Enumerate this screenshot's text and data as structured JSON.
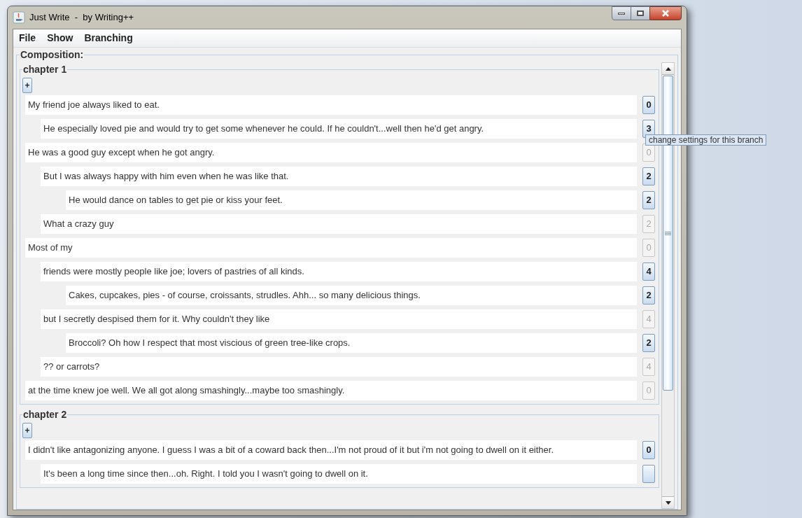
{
  "window": {
    "title": "Just Write  -  by Writing++"
  },
  "menu": [
    "File",
    "Show",
    "Branching"
  ],
  "composition": {
    "label": "Composition:",
    "chapters": [
      {
        "title": "chapter 1",
        "add_button": "+",
        "branches": [
          {
            "text": "My friend joe always liked to eat.",
            "count": "0",
            "enabled": true,
            "children": [
              {
                "text": "He especially loved pie and would try to get some whenever he could. If he couldn't...well then he'd get angry.",
                "count": "3",
                "enabled": true,
                "tooltip": "change settings for this branch"
              }
            ]
          },
          {
            "text": "He was a good guy except when he got angry.",
            "count": "0",
            "enabled": false,
            "children": [
              {
                "text": "But I was always happy with him even when he was like that.",
                "count": "2",
                "enabled": true,
                "children": [
                  {
                    "text": "He would dance on tables to get pie or kiss your feet.",
                    "count": "2",
                    "enabled": true
                  }
                ]
              },
              {
                "text": "What a crazy guy",
                "count": "2",
                "enabled": false
              }
            ]
          },
          {
            "text": "Most of my",
            "count": "0",
            "enabled": false,
            "children": [
              {
                "text": "friends were mostly people like joe; lovers of pastries of all kinds.",
                "count": "4",
                "enabled": true,
                "children": [
                  {
                    "text": "Cakes, cupcakes, pies - of course, croissants, strudles. Ahh... so many delicious things.",
                    "count": "2",
                    "enabled": true
                  }
                ]
              },
              {
                "text": "but I secretly despised them for it. Why couldn't they like",
                "count": "4",
                "enabled": false,
                "children": [
                  {
                    "text": "Broccoli? Oh how I respect that most viscious of green tree-like crops.",
                    "count": "2",
                    "enabled": true
                  }
                ]
              },
              {
                "text": "?? or carrots?",
                "count": "4",
                "enabled": false
              }
            ]
          },
          {
            "text": "at the time knew joe well. We all got along smashingly...maybe too smashingly.",
            "count": "0",
            "enabled": false
          }
        ]
      },
      {
        "title": "chapter 2",
        "add_button": "+",
        "branches": [
          {
            "text": "I didn't like antagonizing anyone. I guess I was a bit of a coward back then...I'm not proud of it but i'm not going to dwell on it either.",
            "count": "0",
            "enabled": true,
            "children": [
              {
                "text": "It's been a long time since then...oh. Right. I told you I wasn't going to dwell on it.",
                "enabled": true
              }
            ]
          }
        ]
      }
    ]
  }
}
